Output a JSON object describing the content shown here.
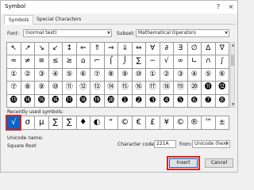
{
  "window": {
    "title": "Symbol",
    "help": "?",
    "close": "×"
  },
  "tabs": [
    "Symbols",
    "Special Characters"
  ],
  "font": {
    "label": "Font:",
    "value": "(normal text)"
  },
  "subset": {
    "label": "Subset:",
    "value": "Mathematical Operators"
  },
  "grid": [
    [
      "↖",
      "↗",
      "↘",
      "↙",
      "↕",
      "⇐",
      "⇑",
      "⇒",
      "⇓",
      "⇔",
      "∀",
      "∂",
      "∃",
      "∅",
      "∆",
      "∇"
    ],
    [
      "≈",
      "≠",
      "≡",
      "≤",
      "≥",
      "⌂",
      "⌐",
      "⌠",
      "⌡",
      "∑",
      "−",
      "√",
      "∞",
      "∟",
      "∩",
      "∫"
    ],
    [
      "①",
      "②",
      "③",
      "④",
      "⑤",
      "⑥",
      "⑦",
      "⑧",
      "⑨",
      "⑩",
      "①",
      "②",
      "③",
      "④",
      "⑤",
      "⑥"
    ],
    [
      "⑦",
      "⑧",
      "⑨",
      "⑩",
      "⑪",
      "⑫",
      "⑬",
      "⑭",
      "⑮",
      "⑯",
      "⑰",
      "⑱",
      "⑲",
      "⑳",
      "⓫",
      "⓬"
    ],
    [
      "⓭",
      "⓮",
      "⓯",
      "⓰",
      "⓱",
      "⓲",
      "⓳",
      "⓴",
      "➊",
      "➋",
      "➌",
      "➍",
      "➎",
      "➏",
      "➐",
      "➑"
    ]
  ],
  "recent": {
    "label": "Recently used symbols:",
    "symbols": [
      "√",
      "σ",
      "µ",
      "∑",
      "∑",
      "♦",
      "◐",
      "“",
      "©",
      "€",
      "£",
      "¥",
      "©",
      "®",
      "™",
      "±"
    ]
  },
  "unicode_name": {
    "label": "Unicode name:",
    "value": "Square Root"
  },
  "character_code": {
    "label": "Character code:",
    "value": "221A"
  },
  "from": {
    "label": "from:",
    "value": "Unicode (hex)"
  },
  "buttons": {
    "insert": "Insert",
    "cancel": "Cancel"
  },
  "colors": {
    "highlight": "#e02020",
    "selection": "#0a64c8"
  }
}
